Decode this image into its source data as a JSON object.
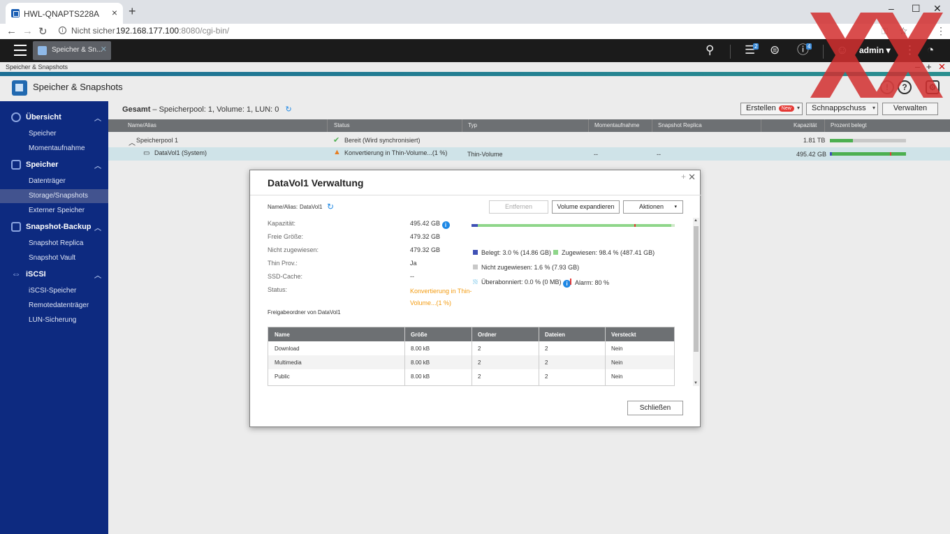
{
  "browser": {
    "tab_title": "HWL-QNAPTS228A",
    "not_secure": "Nicht sicher",
    "url_host": "192.168.177.100",
    "url_rest": ":8080/cgi-bin/"
  },
  "topbar": {
    "app_tab_label": "Speicher & Sn...",
    "tasks_badge": "2",
    "info_badge": "4",
    "user": "admin"
  },
  "app": {
    "window_title": "Speicher & Snapshots",
    "header_title": "Speicher & Snapshots"
  },
  "sidebar": {
    "sections": [
      {
        "label": "Übersicht",
        "items": [
          "Speicher",
          "Momentaufnahme"
        ]
      },
      {
        "label": "Speicher",
        "items": [
          "Datenträger",
          "Storage/Snapshots",
          "Externer Speicher"
        ]
      },
      {
        "label": "Snapshot-Backup",
        "items": [
          "Snapshot Replica",
          "Snapshot Vault"
        ]
      },
      {
        "label": "iSCSI",
        "items": [
          "iSCSI-Speicher",
          "Remotedatenträger",
          "LUN-Sicherung"
        ]
      }
    ],
    "active": "Storage/Snapshots"
  },
  "summary": {
    "label": "Gesamt",
    "text": "– Speicherpool: 1, Volume: 1, LUN: 0"
  },
  "toolbar": {
    "create": "Erstellen",
    "new_badge": "New",
    "snapshot": "Schnappschuss",
    "manage": "Verwalten"
  },
  "table": {
    "headers": [
      "Name/Alias",
      "Status",
      "Typ",
      "Momentaufnahme",
      "Snapshot Replica",
      "Kapazität",
      "Prozent belegt"
    ],
    "rows": [
      {
        "name": "Speicherpool 1",
        "status": "Bereit (Wird synchronisiert)",
        "type": "",
        "snapshot": "",
        "replica": "",
        "capacity": "1.81 TB",
        "used_pct": 30
      },
      {
        "name": "DataVol1 (System)",
        "status": "Konvertierung in Thin-Volume...(1 %)",
        "type": "Thin-Volume",
        "snapshot": "--",
        "replica": "--",
        "capacity": "495.42 GB",
        "used_pct": 3
      }
    ]
  },
  "modal": {
    "title": "DataVol1  Verwaltung",
    "name_label": "Name/Alias:",
    "name_value": "DataVol1",
    "btn_remove": "Entfernen",
    "btn_expand": "Volume expandieren",
    "btn_actions": "Aktionen",
    "fields": [
      {
        "label": "Kapazität:",
        "value": "495.42 GB"
      },
      {
        "label": "Freie Größe:",
        "value": "479.32 GB"
      },
      {
        "label": "Nicht zugewiesen:",
        "value": "479.32 GB"
      },
      {
        "label": "Thin Prov.:",
        "value": "Ja"
      },
      {
        "label": "SSD-Cache:",
        "value": "--"
      },
      {
        "label": "Status:",
        "value": "Konvertierung in Thin-Volume...(1 %)"
      }
    ],
    "legend": {
      "used": "Belegt: 3.0 % (14.86 GB)",
      "assigned": "Zugewiesen: 98.4 % (487.41 GB)",
      "unassigned": "Nicht zugewiesen: 1.6 % (7.93 GB)",
      "oversub": "Überabonniert: 0.0 % (0 MB)",
      "alarm": "Alarm: 80 %"
    },
    "bar": {
      "used_pct": 3.0,
      "assigned_pct": 98.4,
      "alarm_pct": 80
    },
    "shares_title": "Freigabeordner von DataVol1",
    "shares_headers": [
      "Name",
      "Größe",
      "Ordner",
      "Dateien",
      "Versteckt"
    ],
    "shares": [
      [
        "Download",
        "8.00 kB",
        "2",
        "2",
        "Nein"
      ],
      [
        "Multimedia",
        "8.00 kB",
        "2",
        "2",
        "Nein"
      ],
      [
        "Public",
        "8.00 kB",
        "2",
        "2",
        "Nein"
      ]
    ],
    "close": "Schließen"
  },
  "colors": {
    "sidebar": "#0d2a80",
    "accent": "#1e88e5",
    "warning_text": "#f39c12",
    "bar_green": "#4caf50",
    "used_blue": "#3f51b5"
  }
}
